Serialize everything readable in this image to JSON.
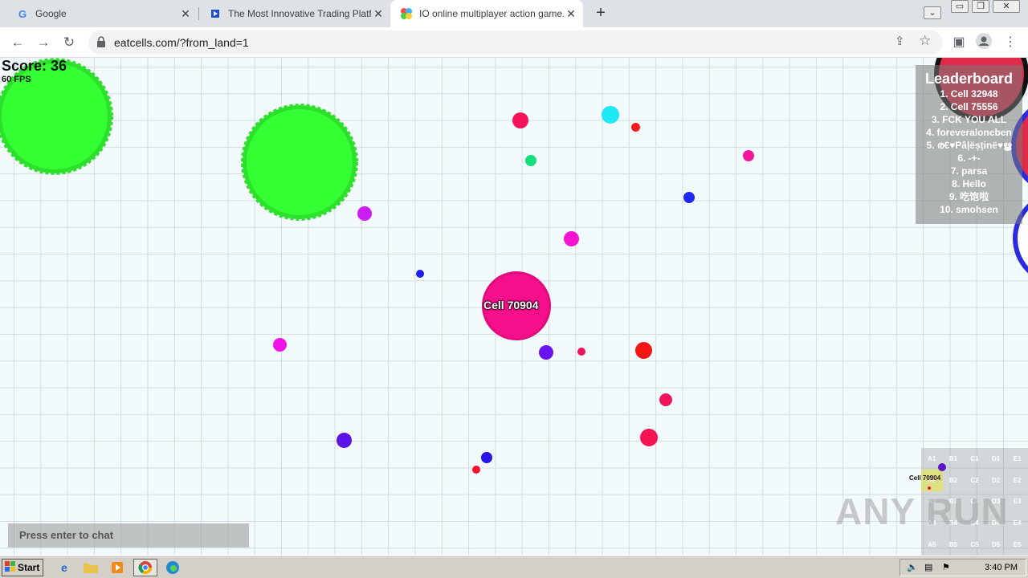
{
  "browser": {
    "tabs": [
      {
        "title": "Google",
        "active": false
      },
      {
        "title": "The Most Innovative Trading Platform",
        "active": false
      },
      {
        "title": "IO online multiplayer action game. S",
        "active": true
      }
    ],
    "url": "eatcells.com/?from_land=1"
  },
  "game": {
    "score_label": "Score: 36",
    "fps_label": "60 FPS",
    "player_name": "Cell 70904",
    "leaderboard": {
      "title": "Leaderboard",
      "entries": [
        "1. Cell 32948",
        "2. Cell 75556",
        "3. FCK YOU ALL",
        "4. foreveraloneben",
        "5. ര€♥Pâļëșținë♥ൠ",
        "6. -+-",
        "7. parsa",
        "8. Hello",
        "9. 吃饱啦",
        "10. smohsen"
      ]
    },
    "chat_placeholder": "Press enter to chat",
    "minimap": {
      "cells": [
        "A1",
        "B1",
        "C1",
        "D1",
        "E1",
        "A2",
        "B2",
        "C2",
        "D2",
        "E2",
        "A3",
        "B3",
        "C3",
        "D3",
        "E3",
        "A4",
        "B4",
        "C4",
        "D4",
        "E4",
        "A5",
        "B5",
        "C5",
        "D5",
        "E5"
      ],
      "player_label": "Cell 70904"
    },
    "colors": {
      "player": "#ff1493",
      "virus": "#33ff33"
    },
    "watermark": "ANY RUN"
  },
  "taskbar": {
    "start_label": "Start",
    "clock": "3:40 PM"
  }
}
